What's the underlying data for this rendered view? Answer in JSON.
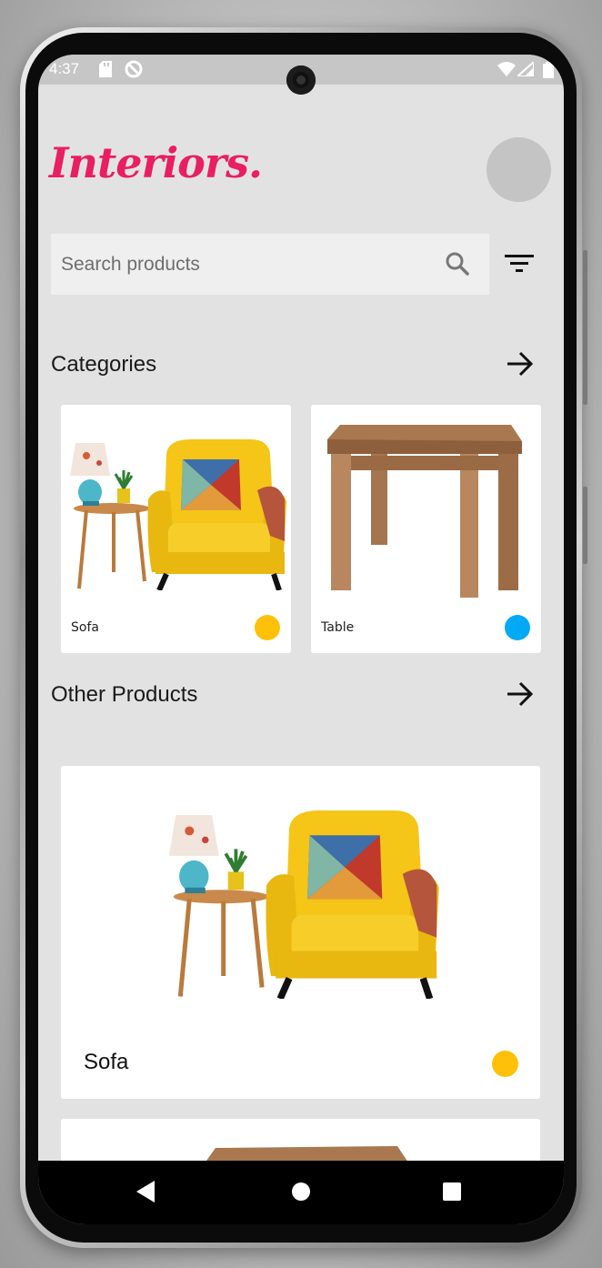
{
  "status_bar": {
    "time": "4:37"
  },
  "header": {
    "brand": "Interiors."
  },
  "search": {
    "placeholder": "Search products"
  },
  "categories": {
    "title": "Categories",
    "items": [
      {
        "label": "Sofa",
        "color": "#ffc107"
      },
      {
        "label": "Table",
        "color": "#03a9f4"
      }
    ]
  },
  "other_products": {
    "title": "Other Products",
    "items": [
      {
        "label": "Sofa",
        "color": "#ffc107"
      }
    ]
  },
  "icons": {
    "search": "search-icon",
    "filter": "filter-icon",
    "arrow": "arrow-right-icon",
    "back": "back-icon",
    "home": "home-icon",
    "recents": "recents-icon"
  }
}
